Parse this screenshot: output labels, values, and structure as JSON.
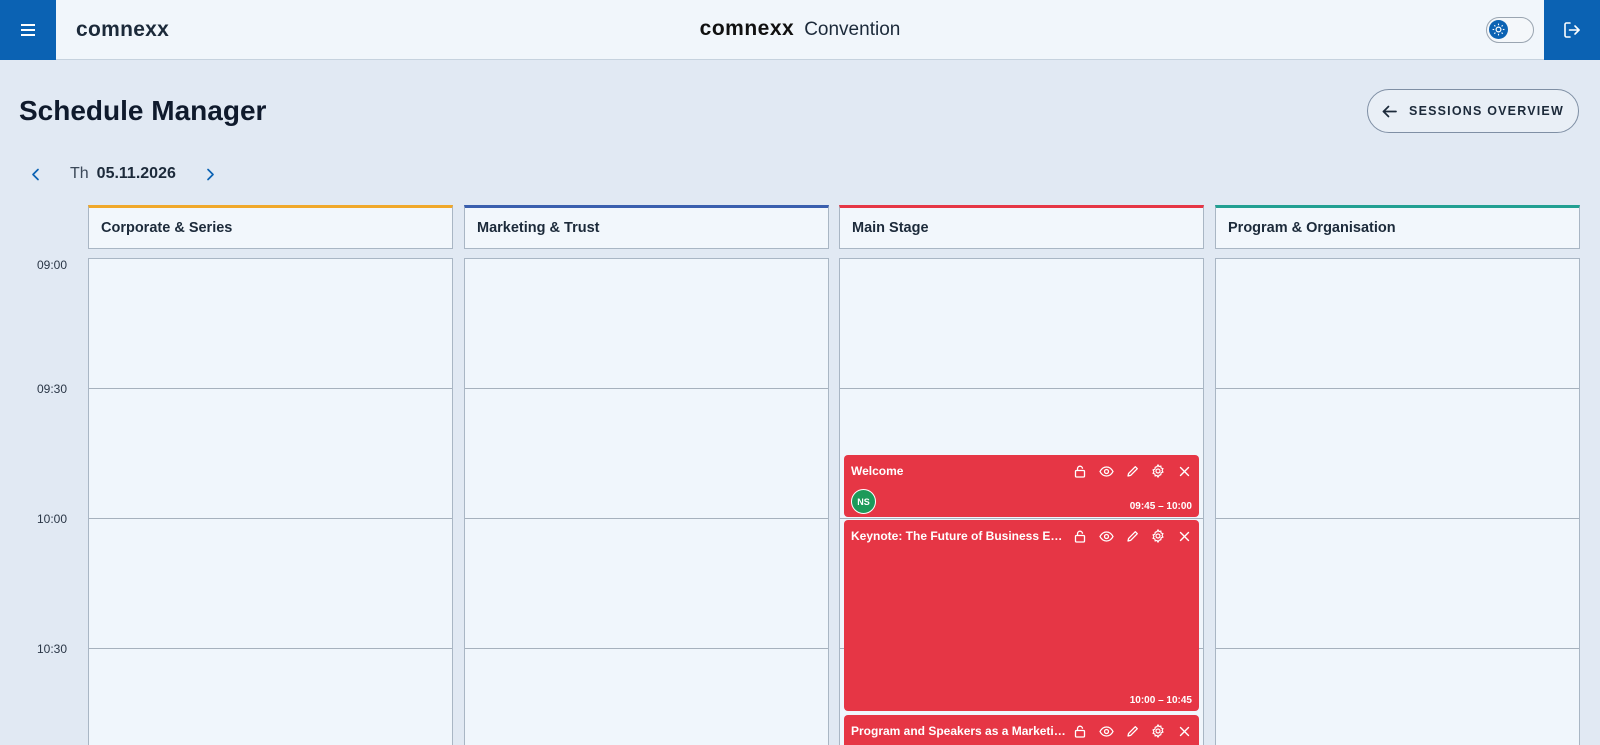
{
  "header": {
    "app_name": "comnexx",
    "center_logo": "comnexx",
    "center_title": "Convention",
    "theme_toggle_icon": "sun-icon",
    "menu_icon": "hamburger-icon",
    "logout_icon": "logout-icon"
  },
  "page": {
    "title": "Schedule Manager",
    "sessions_overview_label": "SESSIONS OVERVIEW"
  },
  "date_nav": {
    "day": "Th",
    "date": "05.11.2026"
  },
  "columns": [
    {
      "label": "Corporate & Series",
      "color": "#f0a82a"
    },
    {
      "label": "Marketing & Trust",
      "color": "#3a5fae"
    },
    {
      "label": "Main Stage",
      "color": "#e63645"
    },
    {
      "label": "Program & Organisation",
      "color": "#22a092"
    }
  ],
  "times": [
    "09:00",
    "09:30",
    "10:00",
    "10:30"
  ],
  "sessions": [
    {
      "title": "Welcome",
      "time": "09:45 – 10:00",
      "avatar": "NS",
      "color": "#e63645"
    },
    {
      "title": "Keynote: The Future of Business Events",
      "time": "10:00 – 10:45",
      "color": "#e63645"
    },
    {
      "title": "Program and Speakers as a Marketing Tool",
      "time": "",
      "color": "#e63645"
    }
  ],
  "colors": {
    "primary": "#0b62b3",
    "session_red": "#e63645",
    "avatar_green": "#1c9a5a"
  }
}
